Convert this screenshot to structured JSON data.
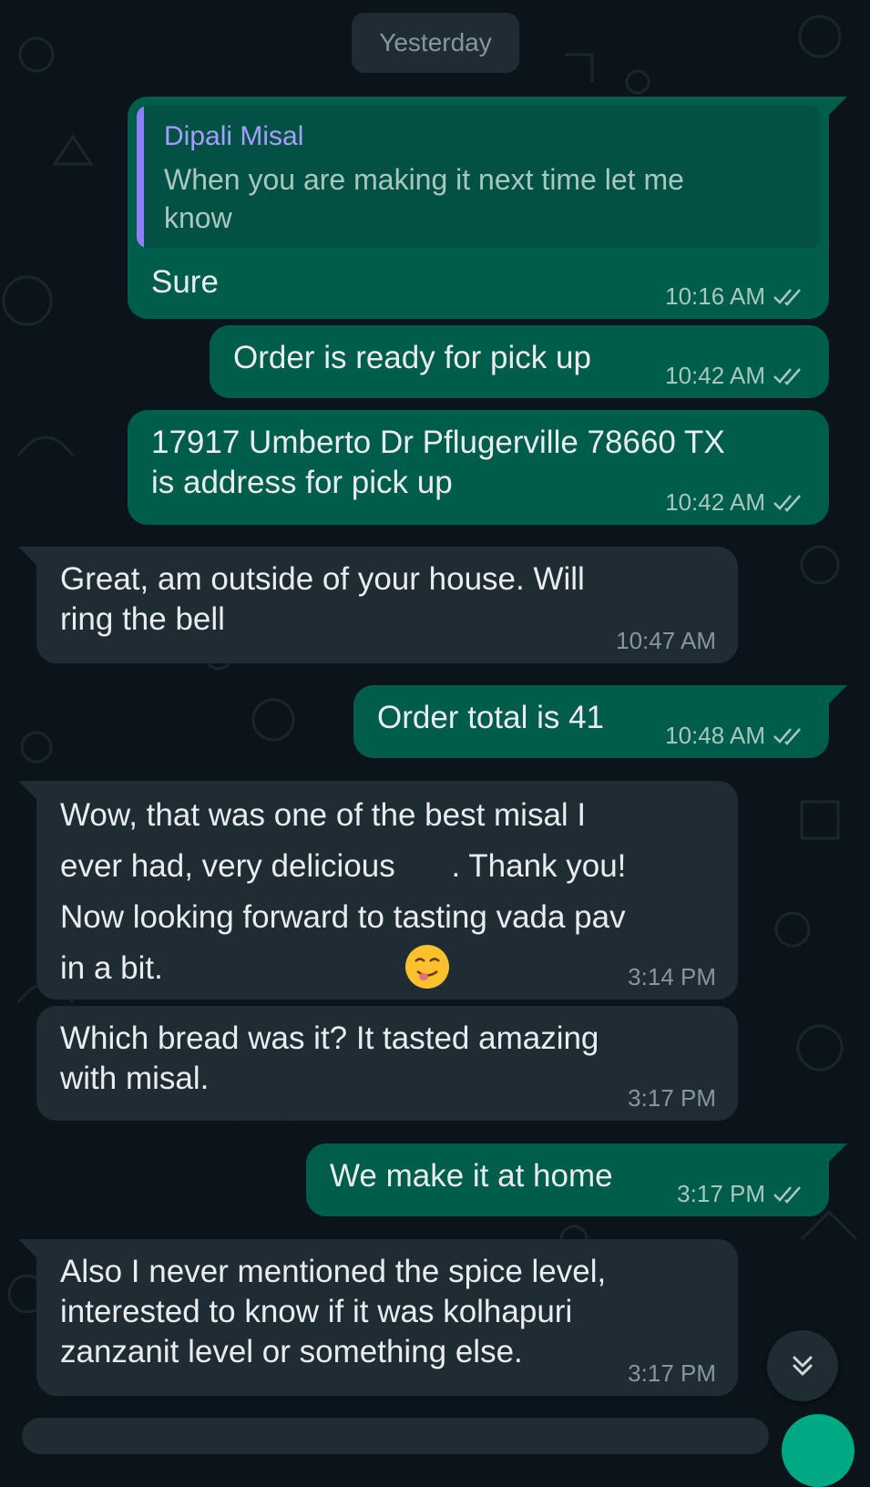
{
  "date_divider": "Yesterday",
  "messages": [
    {
      "direction": "out",
      "quote": {
        "author": "Dipali Misal",
        "text": "When you are making it next time let me\nknow"
      },
      "text": "Sure",
      "time": "10:16 AM",
      "status": "read"
    },
    {
      "direction": "out",
      "text": "Order is ready for pick up",
      "time": "10:42 AM",
      "status": "read"
    },
    {
      "direction": "out",
      "text": "17917 Umberto Dr Pflugerville 78660 TX\nis address for pick up",
      "time": "10:42 AM",
      "status": "read"
    },
    {
      "direction": "in",
      "text": "Great, am outside of your house. Will\nring the bell",
      "time": "10:47 AM"
    },
    {
      "direction": "out",
      "text": "Order total is 41",
      "time": "10:48 AM",
      "status": "read"
    },
    {
      "direction": "in",
      "text_line1": "Wow, that was one of the best misal I",
      "text_line2a": "ever had, very delicious",
      "text_line2b": ". Thank you!",
      "text_rest": "Now looking forward to tasting vada pav\nin a bit.",
      "time": "3:14 PM"
    },
    {
      "direction": "in",
      "text": "Which bread was it? It tasted amazing\nwith misal.",
      "time": "3:17 PM"
    },
    {
      "direction": "out",
      "text": "We make it at home",
      "time": "3:17 PM",
      "status": "read"
    },
    {
      "direction": "in",
      "text": "Also I never mentioned the spice level,\ninterested to know if it was kolhapuri\nzanzanit level or something else.",
      "time": "3:17 PM"
    }
  ],
  "icons": {
    "read_receipt": "double-check-icon",
    "scroll_down": "chevron-double-down-icon",
    "smile_emoji": "smiling-face-emoji",
    "yum_emoji": "face-savoring-food-emoji"
  },
  "colors": {
    "background": "#0b141a",
    "outgoing_bubble": "#005c4b",
    "incoming_bubble": "#1f2c34",
    "quote_accent": "#8b80f8",
    "read_tick": "#a6c8c0"
  }
}
